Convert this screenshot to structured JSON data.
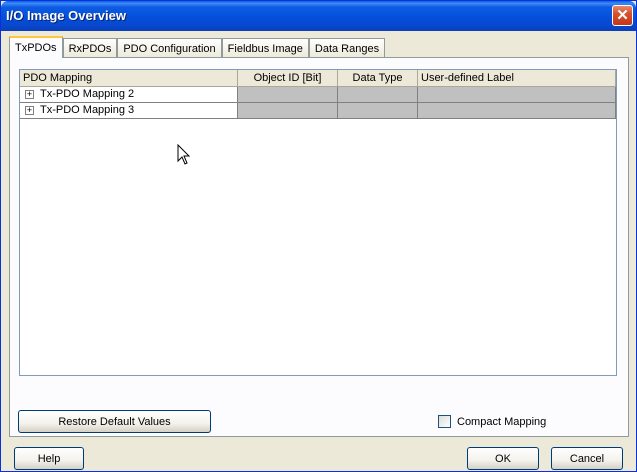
{
  "window": {
    "title": "I/O Image Overview",
    "close_label": "✕"
  },
  "tabs": [
    {
      "label": "TxPDOs",
      "active": true
    },
    {
      "label": "RxPDOs",
      "active": false
    },
    {
      "label": "PDO Configuration",
      "active": false
    },
    {
      "label": "Fieldbus Image",
      "active": false
    },
    {
      "label": "Data Ranges",
      "active": false
    }
  ],
  "table": {
    "columns": [
      "PDO Mapping",
      "Object ID [Bit]",
      "Data Type",
      "User-defined Label"
    ],
    "rows": [
      {
        "name": "Tx-PDO Mapping 2",
        "object_id": "",
        "data_type": "",
        "label": ""
      },
      {
        "name": "Tx-PDO Mapping 3",
        "object_id": "",
        "data_type": "",
        "label": ""
      }
    ],
    "expander_glyph": "+"
  },
  "restore_button": "Restore Default Values",
  "compact_mapping": {
    "label": "Compact Mapping",
    "checked": false
  },
  "footer": {
    "help": "Help",
    "ok": "OK",
    "cancel": "Cancel"
  },
  "colors": {
    "titlebar": "#0551dc",
    "grid_cell": "#c0c0c0",
    "dialog_bg": "#ece9d8"
  }
}
